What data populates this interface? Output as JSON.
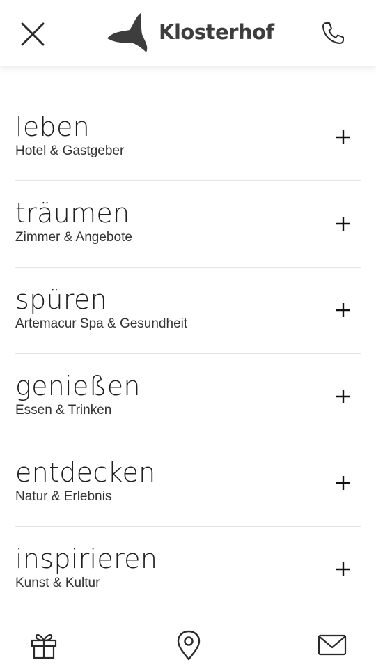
{
  "header": {
    "brand": "Klosterhof",
    "icons": {
      "close": "close-icon",
      "logo": "klosterhof-logo-icon",
      "phone": "phone-icon"
    }
  },
  "menu": {
    "items": [
      {
        "title": "leben",
        "subtitle": "Hotel & Gastgeber"
      },
      {
        "title": "träumen",
        "subtitle": "Zimmer & Angebote"
      },
      {
        "title": "spüren",
        "subtitle": "Artemacur Spa & Gesundheit"
      },
      {
        "title": "genießen",
        "subtitle": "Essen & Trinken"
      },
      {
        "title": "entdecken",
        "subtitle": "Natur & Erlebnis"
      },
      {
        "title": "inspirieren",
        "subtitle": "Kunst & Kultur"
      }
    ],
    "expand_icon": "plus-icon"
  },
  "bottom_bar": {
    "icons": [
      "gift-icon",
      "map-pin-icon",
      "mail-icon"
    ]
  },
  "colors": {
    "text": "#1f1f1f",
    "logo": "#3d3d3d",
    "divider": "#e6e6e6",
    "background": "#ffffff"
  }
}
